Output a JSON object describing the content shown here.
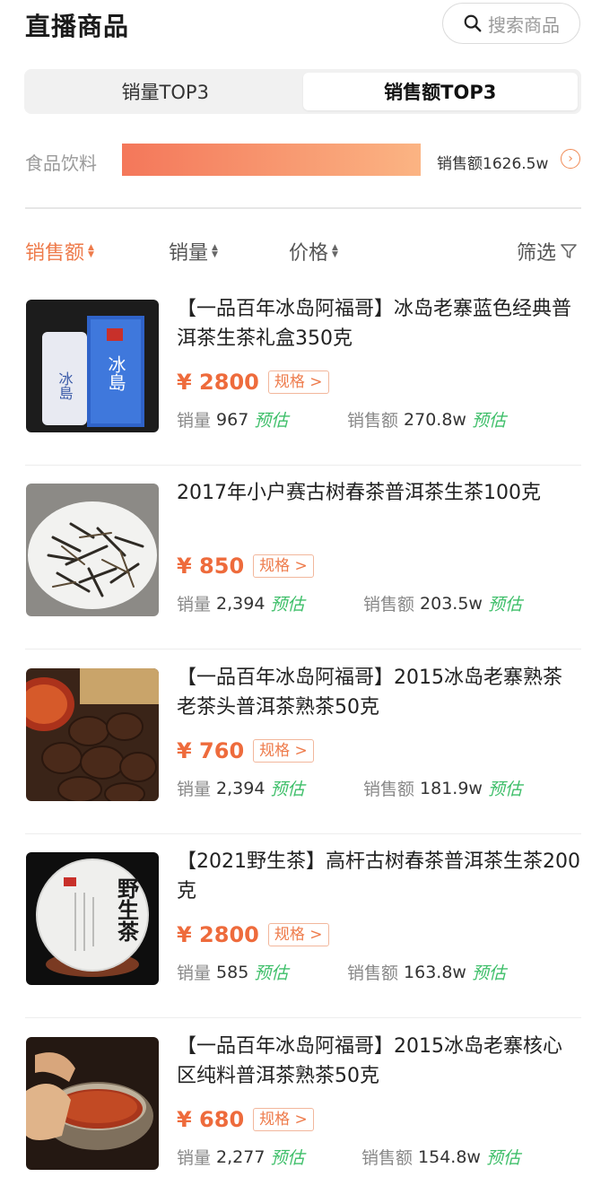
{
  "header": {
    "title": "直播商品",
    "search_label": "搜索商品"
  },
  "tabs": [
    {
      "label": "销量TOP3",
      "active": false
    },
    {
      "label": "销售额TOP3",
      "active": true
    }
  ],
  "category": {
    "label": "食品饮料",
    "value_text": "销售额1626.5w",
    "bar_fill_fraction": 1.0,
    "bar_color_start": "#f4775a",
    "bar_color_end": "#fbb483"
  },
  "sort_bar": {
    "sales_amount": "销售额",
    "sales_volume": "销量",
    "price": "价格",
    "filter": "筛选"
  },
  "products": [
    {
      "title": "【一品百年冰岛阿福哥】冰岛老寨蓝色经典普洱茶生茶礼盒350克",
      "price": "¥ 2800",
      "spec": "规格 >",
      "volume_label": "销量",
      "volume": "967",
      "volume_est": "预估",
      "amount_label": "销售额",
      "amount": "270.8w",
      "amount_est": "预估"
    },
    {
      "title": "2017年小户赛古树春茶普洱茶生茶100克",
      "price": "¥ 850",
      "spec": "规格 >",
      "volume_label": "销量",
      "volume": "2,394",
      "volume_est": "预估",
      "amount_label": "销售额",
      "amount": "203.5w",
      "amount_est": "预估"
    },
    {
      "title": "【一品百年冰岛阿福哥】2015冰岛老寨熟茶老茶头普洱茶熟茶50克",
      "price": "¥ 760",
      "spec": "规格 >",
      "volume_label": "销量",
      "volume": "2,394",
      "volume_est": "预估",
      "amount_label": "销售额",
      "amount": "181.9w",
      "amount_est": "预估"
    },
    {
      "title": "【2021野生茶】高杆古树春茶普洱茶生茶200克",
      "price": "¥ 2800",
      "spec": "规格 >",
      "volume_label": "销量",
      "volume": "585",
      "volume_est": "预估",
      "amount_label": "销售额",
      "amount": "163.8w",
      "amount_est": "预估"
    },
    {
      "title": "【一品百年冰岛阿福哥】2015冰岛老寨核心区纯料普洱茶熟茶50克",
      "price": "¥ 680",
      "spec": "规格 >",
      "volume_label": "销量",
      "volume": "2,277",
      "volume_est": "预估",
      "amount_label": "销售额",
      "amount": "154.8w",
      "amount_est": "预估"
    }
  ],
  "thumb_text": {
    "product_1_box": "冰島",
    "product_4_cake": "野生茶"
  },
  "colors": {
    "accent": "#ee7b4b",
    "price": "#ee6b3c",
    "estimate_tag": "#3fbf6a"
  }
}
